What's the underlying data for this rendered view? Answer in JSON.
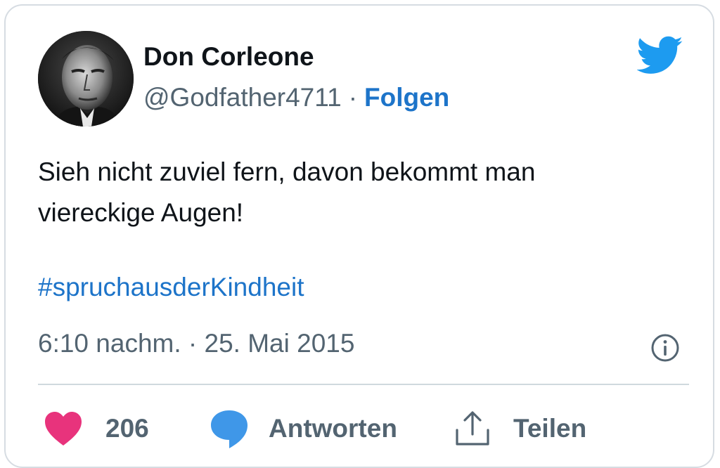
{
  "tweet": {
    "display_name": "Don Corleone",
    "handle": "@Godfather4711",
    "separator": "·",
    "follow_label": "Folgen",
    "text_line1": "Sieh nicht zuviel fern, davon bekommt man",
    "text_line2": "viereckige Augen!",
    "hashtag": "#spruchausderKindheit",
    "timestamp": "6:10 nachm. · 25. Mai 2015"
  },
  "actions": {
    "like_count": "206",
    "reply_label": "Antworten",
    "share_label": "Teilen"
  },
  "icons": {
    "brand": "twitter-bird-icon",
    "info": "info-icon",
    "like": "heart-icon",
    "reply": "speech-bubble-icon",
    "share": "share-icon"
  },
  "colors": {
    "twitter_blue": "#1d9bf0",
    "link_blue": "#1d74c9",
    "like_pink": "#e8337c",
    "reply_blue": "#3f97e8",
    "muted_gray": "#536471"
  }
}
